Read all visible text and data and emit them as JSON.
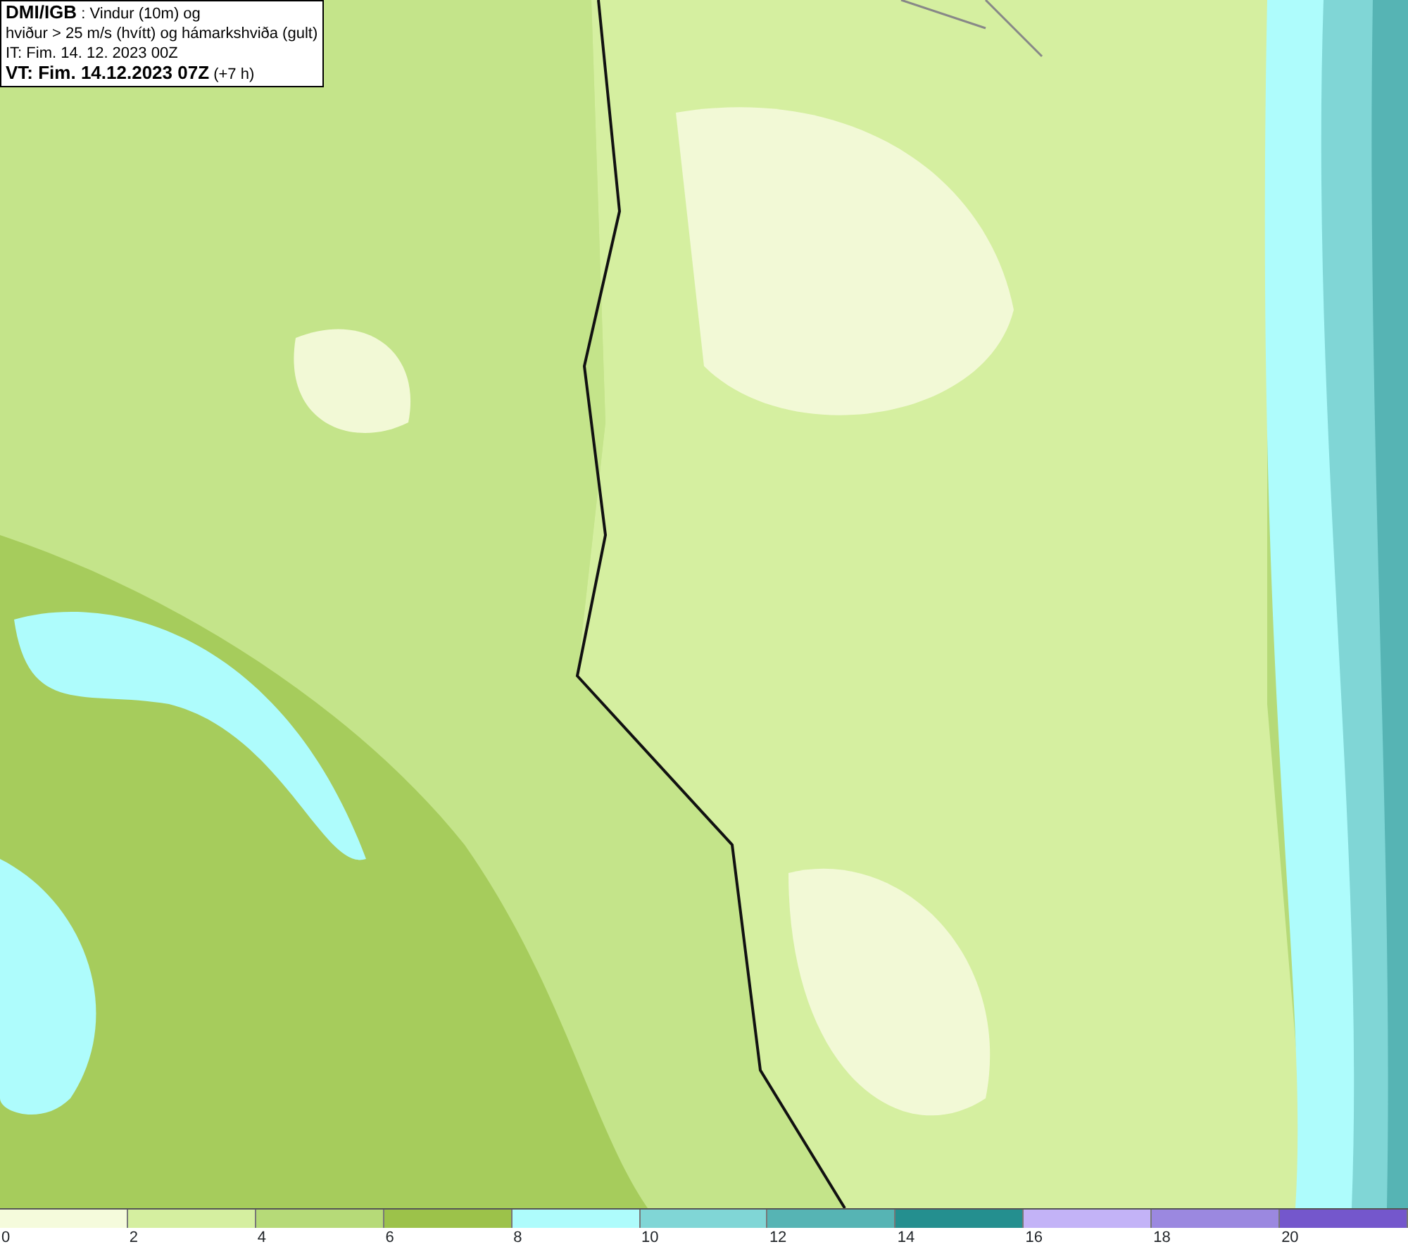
{
  "legend": {
    "lines": [
      "**DMI/IGB** : Vindur (10m) og",
      "hviður > 25 m/s (hvítt) og hámarkshviða (gult)",
      "IT: Fim. 14. 12. 2023 00Z",
      "**VT: Fim. 14.12.2023 07Z** (+7 h)"
    ]
  },
  "color_scale": [
    {
      "label": "0",
      "color": "#f5fbdc"
    },
    {
      "label": "2",
      "color": "#d5efa0"
    },
    {
      "label": "4",
      "color": "#b6da78"
    },
    {
      "label": "6",
      "color": "#9cc24a"
    },
    {
      "label": "8",
      "color": "#aefcfc"
    },
    {
      "label": "10",
      "color": "#80d6d6"
    },
    {
      "label": "12",
      "color": "#56b4b4"
    },
    {
      "label": "14",
      "color": "#248f8f"
    },
    {
      "label": "16",
      "color": "#c3b3f7"
    },
    {
      "label": "18",
      "color": "#9b88e0"
    },
    {
      "label": "20",
      "color": "#7457cc"
    }
  ]
}
